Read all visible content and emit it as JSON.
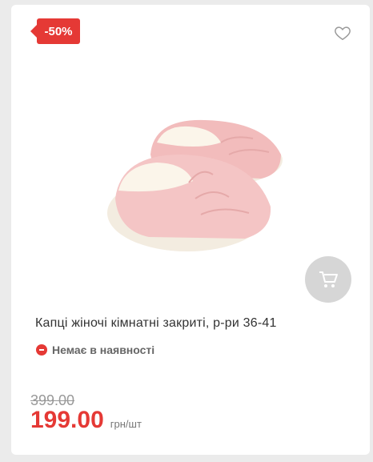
{
  "badge": {
    "discount": "-50%"
  },
  "icons": {
    "favorite": "heart-outline-icon",
    "cart": "shopping-cart-icon",
    "availability": "minus-circle-icon"
  },
  "product": {
    "title": "Капці жіночі кімнатні закриті, р-ри 36-41",
    "availability": "Немає в наявності",
    "old_price": "399.00",
    "price": "199.00",
    "unit": "грн/шт"
  },
  "colors": {
    "accent": "#e53935",
    "cart_button": "#d6d6d6",
    "slipper": "#f4c5c5"
  }
}
